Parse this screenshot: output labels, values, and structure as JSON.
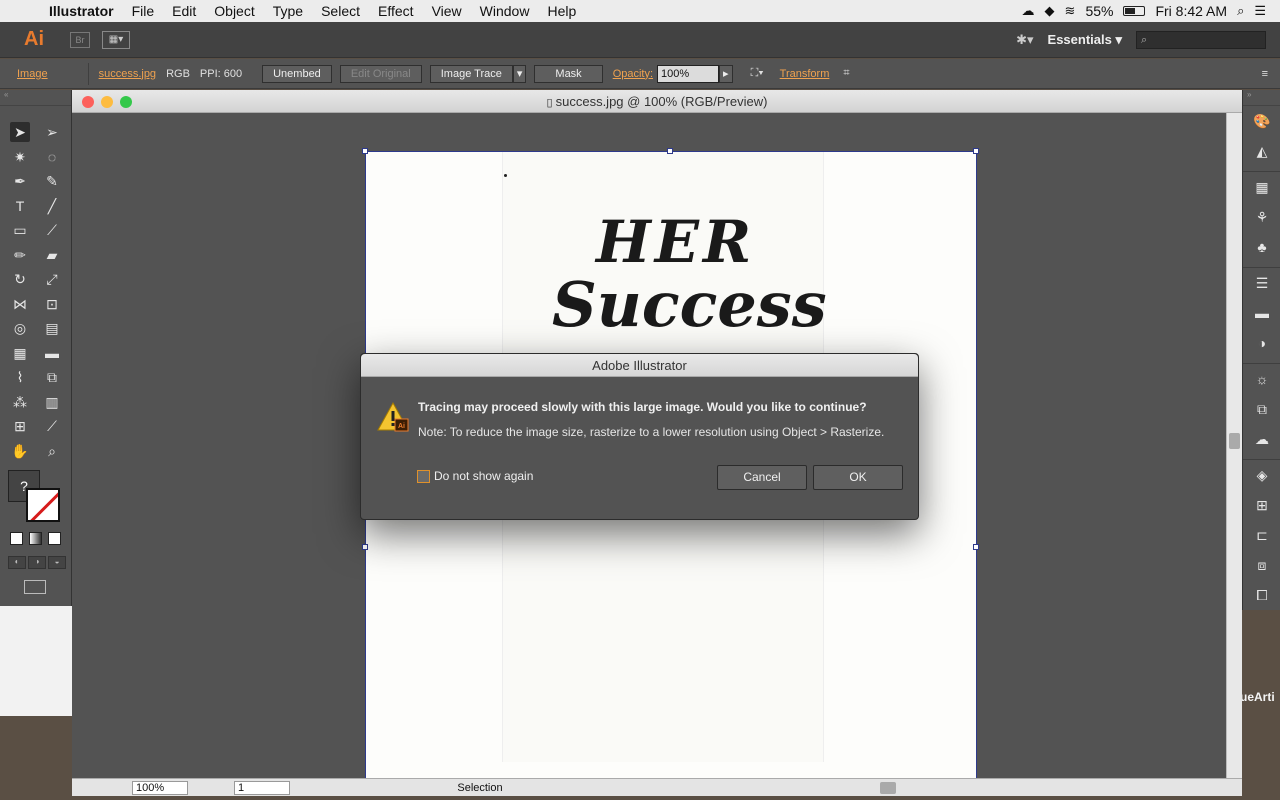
{
  "menubar": {
    "app_name": "Illustrator",
    "menus": [
      "File",
      "Edit",
      "Object",
      "Type",
      "Select",
      "Effect",
      "View",
      "Window",
      "Help"
    ],
    "battery": "55%",
    "clock": "Fri 8:42 AM"
  },
  "appbar": {
    "logo": "Ai",
    "bridge": "Br",
    "workspace": "Essentials"
  },
  "controlbar": {
    "object_type": "Image",
    "file_link": "success.jpg",
    "color_mode": "RGB",
    "ppi": "PPI: 600",
    "unembed": "Unembed",
    "edit_original": "Edit Original",
    "image_trace": "Image Trace",
    "mask": "Mask",
    "opacity_label": "Opacity:",
    "opacity_value": "100%",
    "transform": "Transform"
  },
  "document": {
    "title": "success.jpg @ 100% (RGB/Preview)",
    "lettering_line1": "HER",
    "lettering_line2": "Success",
    "zoom": "100%",
    "page": "1",
    "status": "Selection"
  },
  "desktop": {
    "label": "ueArti"
  },
  "dialog": {
    "title": "Adobe Illustrator",
    "icon_badge": "Ai",
    "message": "Tracing may proceed slowly with this large image. Would you like to continue?",
    "note": "Note: To reduce the image size, rasterize to a lower resolution using Object > Rasterize.",
    "checkbox_label": "Do not show again",
    "checkbox_checked": false,
    "cancel": "Cancel",
    "ok": "OK"
  },
  "colors": {
    "accent": "#e87b2e",
    "link": "#f0a24f",
    "panel": "#535353",
    "artboard_border": "#2e3a8c"
  }
}
